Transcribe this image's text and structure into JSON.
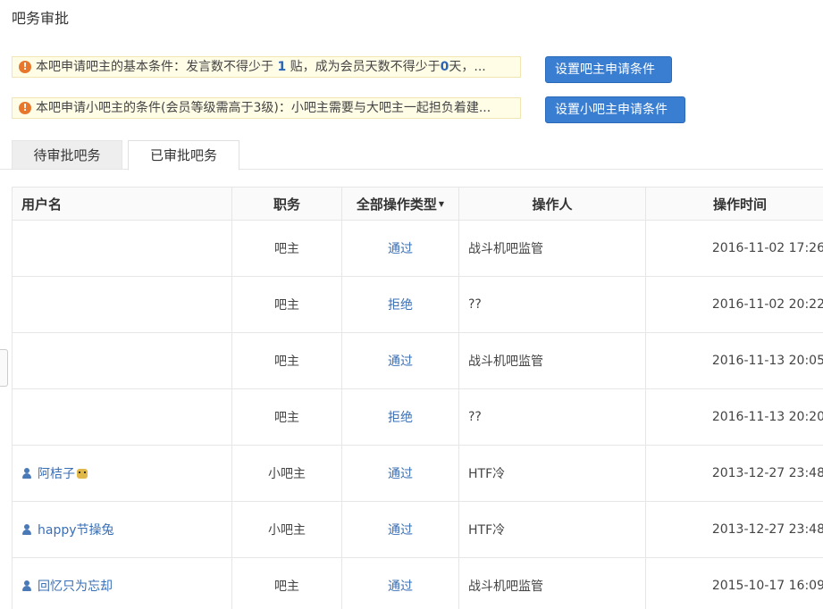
{
  "page": {
    "title": "吧务审批"
  },
  "notices": [
    {
      "before": "本吧申请吧主的基本条件：发言数不得少于 ",
      "num1": "1",
      "middle": " 贴，成为会员天数不得少于",
      "num2": "0",
      "after": "天，..."
    },
    {
      "text": "本吧申请小吧主的条件(会员等级需高于3级)：小吧主需要与大吧主一起担负着建..."
    }
  ],
  "buttons": {
    "set_owner_conditions": "设置吧主申请条件",
    "set_sub_owner_conditions": "设置小吧主申请条件"
  },
  "tabs": [
    {
      "label": "待审批吧务",
      "active": false
    },
    {
      "label": "已审批吧务",
      "active": true
    }
  ],
  "table": {
    "headers": {
      "username": "用户名",
      "role": "职务",
      "type": "全部操作类型",
      "operator": "操作人",
      "time": "操作时间"
    },
    "rows": [
      {
        "username": "",
        "role": "吧主",
        "type": "通过",
        "operator": "战斗机吧监管",
        "time": "2016-11-02 17:26"
      },
      {
        "username": "",
        "role": "吧主",
        "type": "拒绝",
        "operator": "??",
        "time": "2016-11-02 20:22"
      },
      {
        "username": "",
        "role": "吧主",
        "type": "通过",
        "operator": "战斗机吧监管",
        "time": "2016-11-13 20:05"
      },
      {
        "username": "",
        "role": "吧主",
        "type": "拒绝",
        "operator": "??",
        "time": "2016-11-13 20:20"
      },
      {
        "username": "阿桔子",
        "role": "小吧主",
        "type": "通过",
        "operator": "HTF冷",
        "time": "2013-12-27 23:48"
      },
      {
        "username": "happy节操兔",
        "role": "小吧主",
        "type": "通过",
        "operator": "HTF冷",
        "time": "2013-12-27 23:48"
      },
      {
        "username": "回忆只为忘却",
        "role": "吧主",
        "type": "通过",
        "operator": "战斗机吧监管",
        "time": "2015-10-17 16:09"
      }
    ]
  },
  "icons": {
    "warning": "warning-icon",
    "user": "user-icon",
    "caret": "caret-down-icon"
  },
  "colors": {
    "primary_button": "#3a7ed1",
    "link": "#3a6fb5",
    "warning": "#e8772e",
    "notice_bg": "#fffde6"
  }
}
